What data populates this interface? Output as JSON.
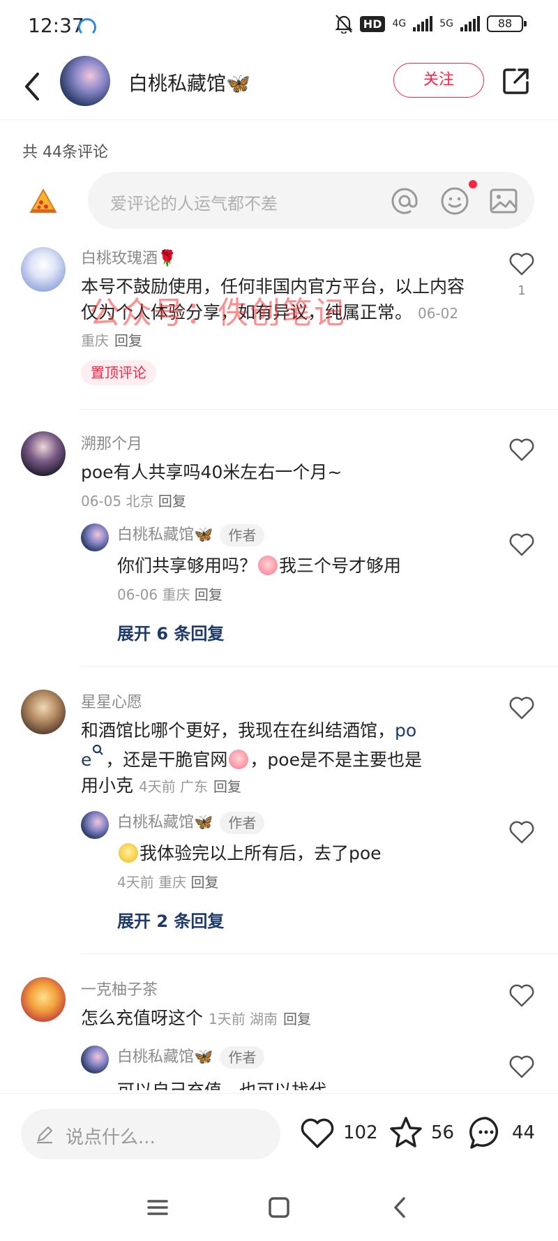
{
  "status_bar": {
    "time": "12:37",
    "network_1": "4G",
    "network_2": "5G",
    "hd_badge": "HD",
    "battery": "88"
  },
  "header": {
    "author_name": "白桃私藏馆🦋",
    "follow_label": "关注"
  },
  "comments_header": {
    "count_text": "共 44条评论",
    "input_placeholder": "爱评论的人运气都不差"
  },
  "watermark": "公众号：佚创笔记",
  "comments": [
    {
      "user": "白桃玫瑰酒🌹",
      "text": "本号不鼓励使用，任何非国内官方平台，以上内容仅为个人体验分享，如有异议，纯属正常。",
      "meta": "06-02 重庆",
      "reply_label": "回复",
      "likes": "1",
      "tag": "置顶评论"
    },
    {
      "user": "溯那个月",
      "text": "poe有人共享吗40米左右一个月~",
      "meta": "06-05 北京",
      "reply_label": "回复",
      "reply": {
        "user": "白桃私藏馆🦋",
        "author_tag": "作者",
        "text_before": "你们共享够用吗？",
        "text_after": "我三个号才够用",
        "meta": "06-06 重庆",
        "reply_label": "回复"
      },
      "expand": "展开 6 条回复"
    },
    {
      "user": "星星心愿",
      "text_line1": "和酒馆比哪个更好，我现在在纠结酒馆，",
      "text_link1": "po",
      "text_link2": "e",
      "text_mid": "，还是干脆官网",
      "text_after": "，poe是不是主要也是",
      "text_line3": "用小克",
      "meta": "4天前  广东",
      "reply_label": "回复",
      "reply": {
        "user": "白桃私藏馆🦋",
        "author_tag": "作者",
        "text": "我体验完以上所有后，去了poe",
        "meta": "4天前  重庆",
        "reply_label": "回复"
      },
      "expand": "展开 2 条回复"
    },
    {
      "user": "一克柚子茶",
      "text": "怎么充值呀这个",
      "meta": "1天前  湖南",
      "reply_label": "回复",
      "reply": {
        "user": "白桃私藏馆🦋",
        "author_tag": "作者",
        "text": "可以自己充值，也可以找代"
      }
    }
  ],
  "bottom_bar": {
    "input_placeholder": "说点什么...",
    "likes": "102",
    "stars": "56",
    "comments": "44"
  },
  "colors": {
    "accent": "#ff2442",
    "link": "#1d3a6b",
    "muted": "#999999"
  }
}
